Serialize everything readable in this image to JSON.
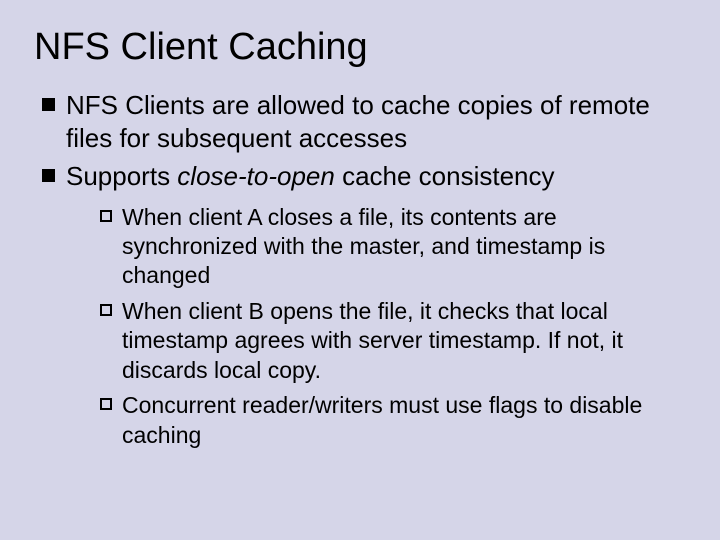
{
  "title": "NFS Client Caching",
  "bullets": [
    {
      "text": "NFS Clients are allowed to cache copies of remote files for subsequent accesses"
    },
    {
      "prefix": "Supports ",
      "italic": "close-to-open",
      "suffix": " cache consistency",
      "sub": [
        "When client A closes a file, its contents are synchronized with the master, and timestamp is changed",
        "When client B opens the file, it checks that local timestamp agrees with server timestamp. If not, it discards local copy.",
        "Concurrent reader/writers must use flags to disable caching"
      ]
    }
  ]
}
